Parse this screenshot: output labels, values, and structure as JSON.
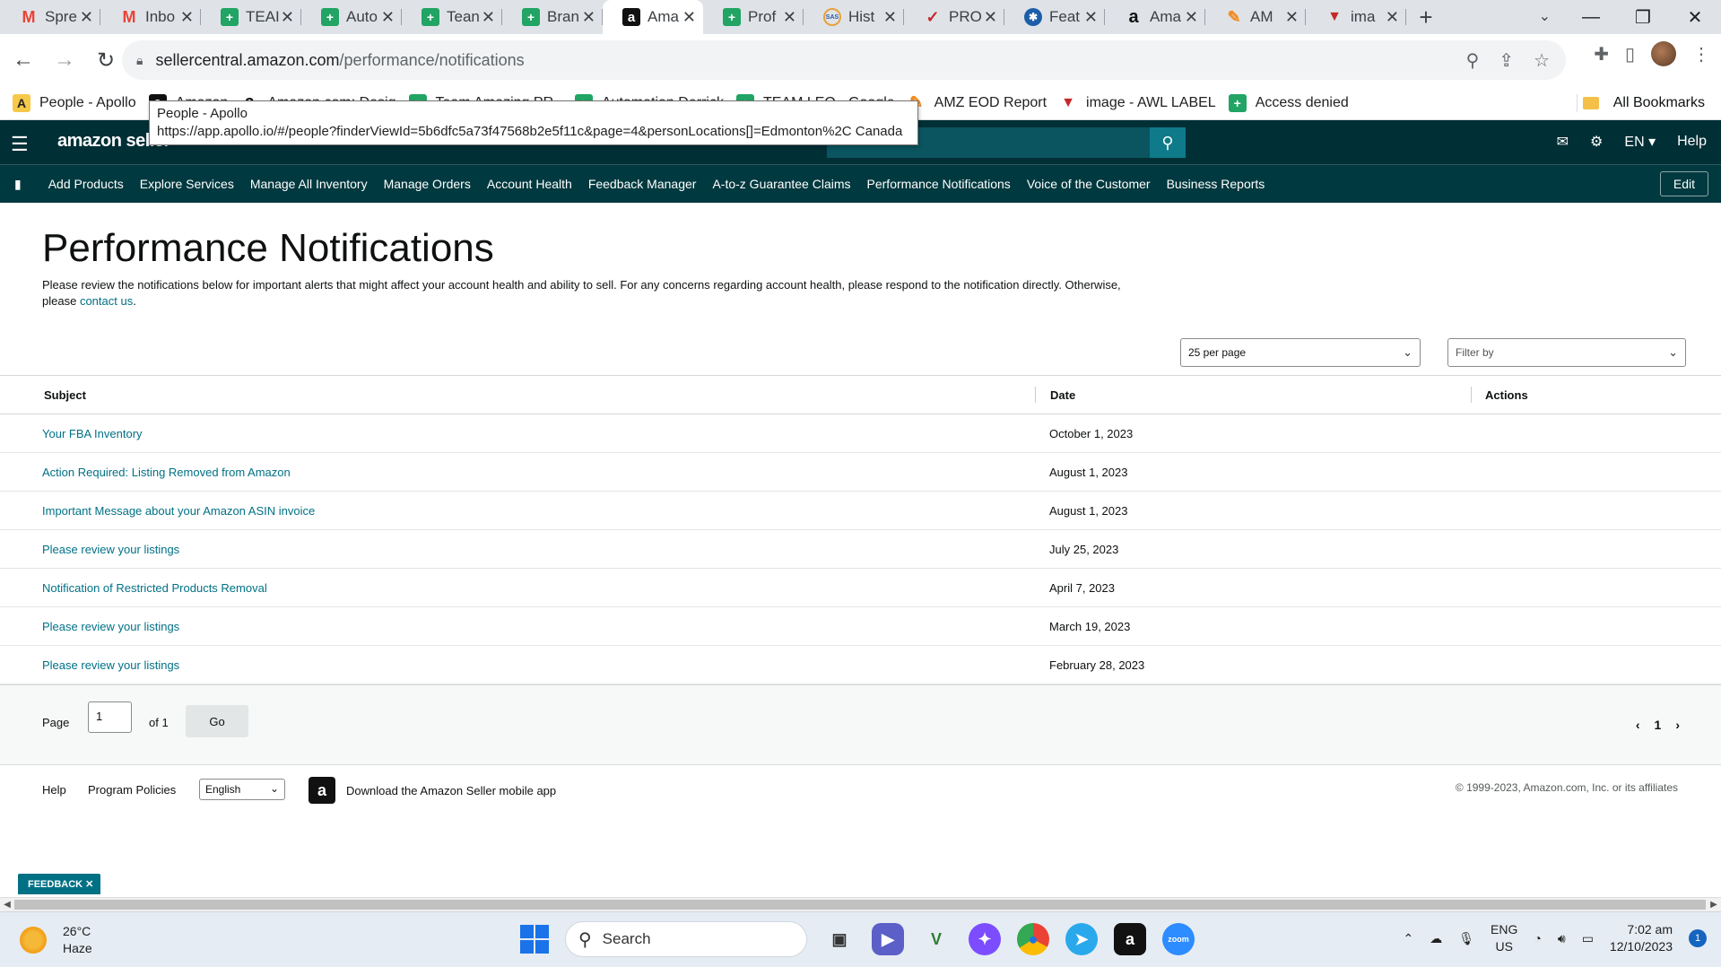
{
  "browser": {
    "tabs": [
      {
        "label": "Spre",
        "icon": "gmail-icon",
        "glyph": "M",
        "type": "gmail"
      },
      {
        "label": "Inbo",
        "icon": "gmail-icon",
        "glyph": "M",
        "type": "gmail"
      },
      {
        "label": "TEAI",
        "icon": "sheets-icon",
        "glyph": "+",
        "type": "sheet"
      },
      {
        "label": "Auto",
        "icon": "sheets-icon",
        "glyph": "+",
        "type": "sheet"
      },
      {
        "label": "Tean",
        "icon": "sheets-icon",
        "glyph": "+",
        "type": "sheet"
      },
      {
        "label": "Bran",
        "icon": "sheets-icon",
        "glyph": "+",
        "type": "sheet"
      },
      {
        "label": "Ama",
        "icon": "amazon-icon",
        "glyph": "a",
        "type": "amz",
        "active": true
      },
      {
        "label": "Prof",
        "icon": "sheets-icon",
        "glyph": "+",
        "type": "sheet"
      },
      {
        "label": "Hist",
        "icon": "sas-icon",
        "glyph": "SAS",
        "type": "sas"
      },
      {
        "label": "PRO",
        "icon": "pen-icon",
        "glyph": "✓",
        "type": "pro"
      },
      {
        "label": "Feat",
        "icon": "feature-icon",
        "glyph": "✱",
        "type": "feat"
      },
      {
        "label": "Ama",
        "icon": "amazon-icon",
        "glyph": "a",
        "type": "amz-w"
      },
      {
        "label": "AM",
        "icon": "amz-eod-icon",
        "glyph": "✎",
        "type": "am"
      },
      {
        "label": "ima",
        "icon": "awl-icon",
        "glyph": "▼",
        "type": "awl"
      }
    ],
    "url_domain": "sellercentral.amazon.com",
    "url_path": "/performance/notifications",
    "bookmarks": [
      {
        "label": "People - Apollo",
        "icon": "apollo-icon",
        "glyph": "A",
        "type": "apollo"
      },
      {
        "label": "Amazon",
        "icon": "amazon-icon",
        "glyph": "a",
        "type": "amz"
      },
      {
        "label": "Amazon.com: Desig",
        "icon": "amazon-icon",
        "glyph": "a",
        "type": "amz-w"
      },
      {
        "label": "Team Amazing PR -",
        "icon": "sheets-icon",
        "glyph": "+",
        "type": "sheet"
      },
      {
        "label": "Automation Derrick",
        "icon": "sheets-icon",
        "glyph": "+",
        "type": "sheet"
      },
      {
        "label": "TEAM LEO - Google",
        "icon": "sheets-icon",
        "glyph": "+",
        "type": "sheet"
      },
      {
        "label": "AMZ EOD Report",
        "icon": "amz-eod-icon",
        "glyph": "✎",
        "type": "am"
      },
      {
        "label": "image - AWL LABEL",
        "icon": "awl-icon",
        "glyph": "▼",
        "type": "awl"
      },
      {
        "label": "Access denied",
        "icon": "sheets-icon",
        "glyph": "+",
        "type": "sheet"
      }
    ],
    "all_bookmarks": "All Bookmarks",
    "tooltip_title": "People - Apollo",
    "tooltip_url": "https://app.apollo.io/#/people?finderViewId=5b6dfc5a73f47568b2e5f11c&page=4&personLocations[]=Edmonton%2C Canada"
  },
  "header": {
    "logo": "amazon seller",
    "lang": "EN ▾",
    "help": "Help",
    "nav": [
      "Add Products",
      "Explore Services",
      "Manage All Inventory",
      "Manage Orders",
      "Account Health",
      "Feedback Manager",
      "A-to-z Guarantee Claims",
      "Performance Notifications",
      "Voice of the Customer",
      "Business Reports"
    ],
    "edit": "Edit"
  },
  "page": {
    "title": "Performance Notifications",
    "intro": "Please review the notifications below for important alerts that might affect your account health and ability to sell. For any concerns regarding account health, please respond to the notification directly. Otherwise, please",
    "contact_link": "contact us",
    "per_page": "25 per page",
    "filter_placeholder": "Filter by",
    "columns": {
      "subject": "Subject",
      "date": "Date",
      "actions": "Actions"
    },
    "rows": [
      {
        "subject": "Your FBA Inventory",
        "date": "October 1, 2023"
      },
      {
        "subject": "Action Required: Listing Removed from Amazon",
        "date": "August 1, 2023"
      },
      {
        "subject": "Important Message about your Amazon ASIN invoice",
        "date": "August 1, 2023"
      },
      {
        "subject": "Please review your listings",
        "date": "July 25, 2023"
      },
      {
        "subject": "Notification of Restricted Products Removal",
        "date": "April 7, 2023"
      },
      {
        "subject": "Please review your listings",
        "date": "March 19, 2023"
      },
      {
        "subject": "Please review your listings",
        "date": "February 28, 2023"
      }
    ],
    "pager": {
      "label": "Page",
      "value": "1",
      "of": "of 1",
      "go": "Go",
      "current": "1"
    }
  },
  "footer": {
    "help": "Help",
    "policies": "Program Policies",
    "language": "English",
    "app_link": "Download the Amazon Seller mobile app",
    "copyright": "© 1999-2023, Amazon.com, Inc. or its affiliates",
    "feedback": "FEEDBACK ✕"
  },
  "taskbar": {
    "temp": "26°C",
    "weather": "Haze",
    "search": "Search",
    "lang_top": "ENG",
    "lang_bottom": "US",
    "time": "7:02 am",
    "date": "12/10/2023",
    "notifications": "1"
  }
}
